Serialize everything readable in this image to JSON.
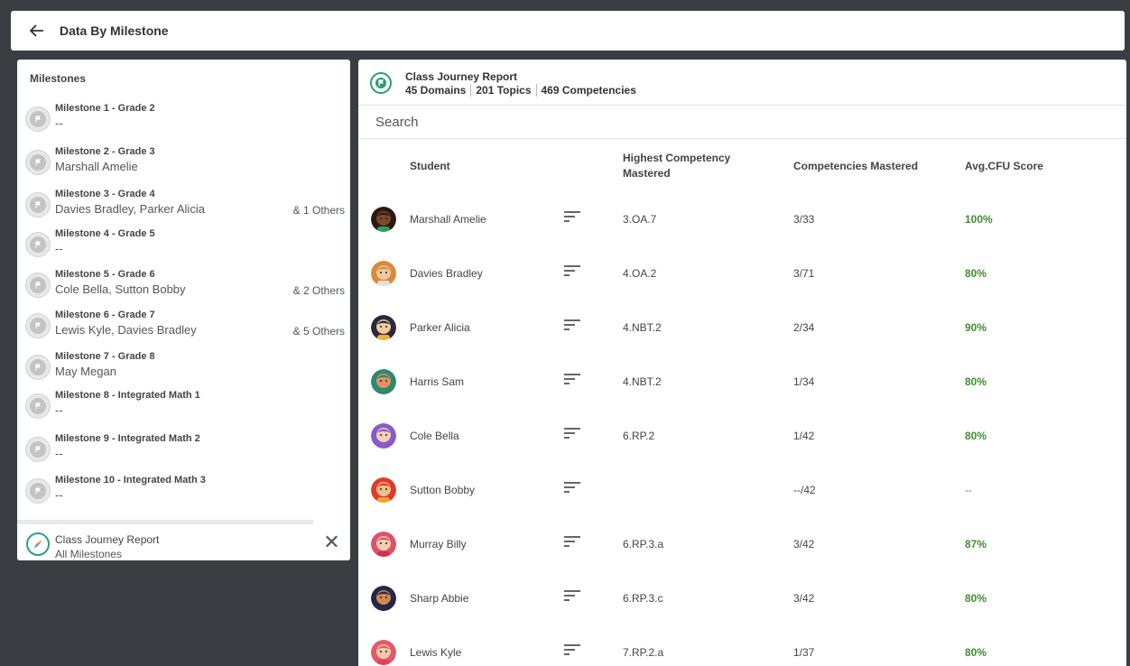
{
  "header": {
    "title": "Data By Milestone"
  },
  "milestones_panel": {
    "title": "Milestones",
    "items": [
      {
        "name": "Milestone 1 - Grade 2",
        "students": "--",
        "others": ""
      },
      {
        "name": "Milestone 2 - Grade 3",
        "students": "Marshall Amelie",
        "others": ""
      },
      {
        "name": "Milestone 3 - Grade 4",
        "students": "Davies Bradley,  Parker Alicia",
        "others": "& 1 Others"
      },
      {
        "name": "Milestone 4 - Grade 5",
        "students": "--",
        "others": ""
      },
      {
        "name": "Milestone 5 - Grade 6",
        "students": "Cole Bella,  Sutton Bobby",
        "others": "& 2 Others"
      },
      {
        "name": "Milestone 6 - Grade 7",
        "students": "Lewis Kyle,  Davies Bradley",
        "others": "& 5 Others"
      },
      {
        "name": "Milestone 7 - Grade 8",
        "students": "May Megan",
        "others": ""
      },
      {
        "name": "Milestone 8 - Integrated Math 1",
        "students": "--",
        "others": ""
      },
      {
        "name": "Milestone 9 - Integrated Math 2",
        "students": "--",
        "others": ""
      },
      {
        "name": "Milestone 10 - Integrated Math 3",
        "students": "--",
        "others": ""
      }
    ],
    "footer": {
      "title": "Class Journey Report",
      "subtitle": "All Milestones",
      "close": "✕"
    }
  },
  "report": {
    "title": "Class Journey Report",
    "stats": [
      "45 Domains",
      "201 Topics",
      "469 Competencies"
    ],
    "search_placeholder": "Search",
    "columns": {
      "student": "Student",
      "highest_1": "Highest Competency",
      "highest_2": "Mastered",
      "mastered": "Competencies Mastered",
      "cfu": "Avg.CFU Score"
    },
    "rows": [
      {
        "student": "Marshall Amelie",
        "highest": "3.OA.7",
        "mastered": "3/33",
        "cfu": "100%",
        "skin": "#7a4a2a",
        "hair": "#2a1a12",
        "shirt": "#2e9e5e"
      },
      {
        "student": "Davies Bradley",
        "highest": "4.OA.2",
        "mastered": "3/71",
        "cfu": "80%",
        "skin": "#f0c8a0",
        "hair": "#d98a3a",
        "shirt": "#e0e0e0"
      },
      {
        "student": "Parker Alicia",
        "highest": "4.NBT.2",
        "mastered": "2/34",
        "cfu": "90%",
        "skin": "#f2c9a4",
        "hair": "#2a2a3a",
        "shirt": "#e8b53a"
      },
      {
        "student": "Harris Sam",
        "highest": "4.NBT.2",
        "mastered": "1/34",
        "cfu": "80%",
        "skin": "#e39060",
        "hair": "#2d8a6e",
        "shirt": "#2d8a6e"
      },
      {
        "student": "Cole Bella",
        "highest": "6.RP.2",
        "mastered": "1/42",
        "cfu": "80%",
        "skin": "#f4d0b8",
        "hair": "#8a5ac8",
        "shirt": "#8a5ac8"
      },
      {
        "student": "Sutton Bobby",
        "highest": "",
        "mastered": "--/42",
        "cfu": "--",
        "skin": "#f0c090",
        "hair": "#e03a2a",
        "shirt": "#f0a030"
      },
      {
        "student": "Murray Billy",
        "highest": "6.RP.3.a",
        "mastered": "3/42",
        "cfu": "87%",
        "skin": "#f5cdb0",
        "hair": "#e0506a",
        "shirt": "#c8384a"
      },
      {
        "student": "Sharp Abbie",
        "highest": "6.RP.3.c",
        "mastered": "3/42",
        "cfu": "80%",
        "skin": "#d08a50",
        "hair": "#23284a",
        "shirt": "#23284a"
      },
      {
        "student": "Lewis Kyle",
        "highest": "7.RP.2.a",
        "mastered": "1/37",
        "cfu": "80%",
        "skin": "#f3c8a8",
        "hair": "#e05a6a",
        "shirt": "#d04a5a"
      }
    ]
  },
  "colors": {
    "background": "#3a3e42",
    "accent_green": "#2e9b73",
    "score_green": "#3e8e2e"
  },
  "icons": {
    "back": "arrow-left-icon",
    "milestone": "flag-icon",
    "sort": "sort-lines-icon",
    "report": "compass-icon",
    "close": "close-icon"
  }
}
